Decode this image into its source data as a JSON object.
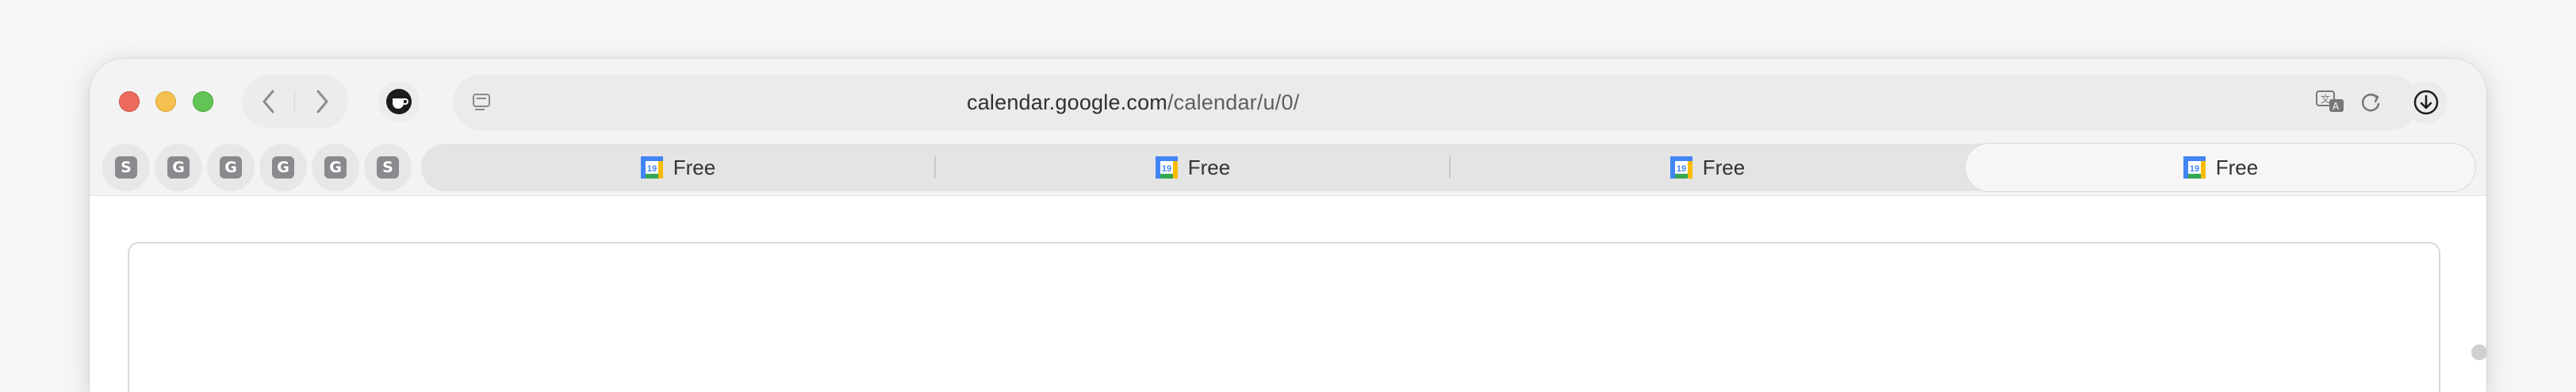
{
  "browser": {
    "url_host": "calendar.google.com",
    "url_path": "/calendar/u/0/",
    "buttons": {
      "back": "chevron-left-icon",
      "forward": "chevron-right-icon",
      "extension": "coffee-cup-icon",
      "reader": "reader-view-icon",
      "translate": "translate-icon",
      "reload": "reload-icon",
      "downloads": "download-icon"
    }
  },
  "pinned_tabs": [
    {
      "letter": "S"
    },
    {
      "letter": "G"
    },
    {
      "letter": "G"
    },
    {
      "letter": "G"
    },
    {
      "letter": "G"
    },
    {
      "letter": "S"
    }
  ],
  "tabs": [
    {
      "label": "Free",
      "icon": "google-calendar-icon",
      "active": false
    },
    {
      "label": "Free",
      "icon": "google-calendar-icon",
      "active": false
    },
    {
      "label": "Free",
      "icon": "google-calendar-icon",
      "active": false
    },
    {
      "label": "Free",
      "icon": "google-calendar-icon",
      "active": true
    }
  ],
  "calendar_icon_number": "19",
  "colors": {
    "close": "#ec6a5e",
    "minimize": "#f5c04f",
    "zoom": "#61c454"
  }
}
